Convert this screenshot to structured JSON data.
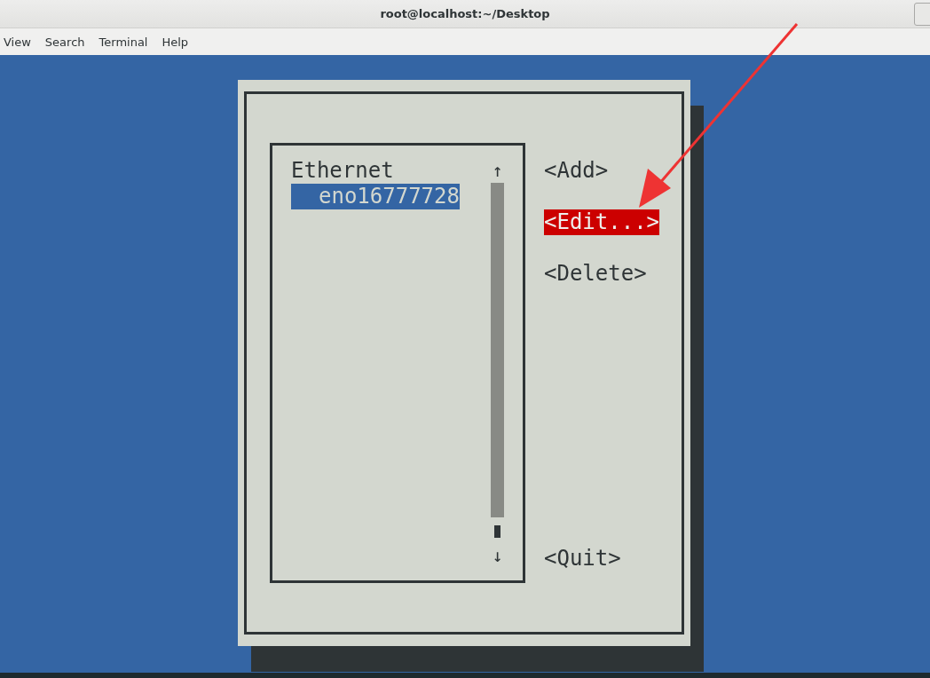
{
  "window": {
    "title": "root@localhost:~/Desktop"
  },
  "menu": [
    "View",
    "Search",
    "Terminal",
    "Help"
  ],
  "connections": {
    "groups": [
      {
        "label": "Ethernet",
        "children": [
          {
            "label": "eno16777728",
            "selected": true
          }
        ]
      }
    ],
    "scroll_up": "↑",
    "scroll_down": "↓"
  },
  "buttons": [
    {
      "label": "<Add>",
      "selected": false
    },
    {
      "label": "<Edit...>",
      "selected": true
    },
    {
      "label": "<Delete>",
      "selected": false
    },
    {
      "label": "<Quit>",
      "selected": false
    }
  ]
}
